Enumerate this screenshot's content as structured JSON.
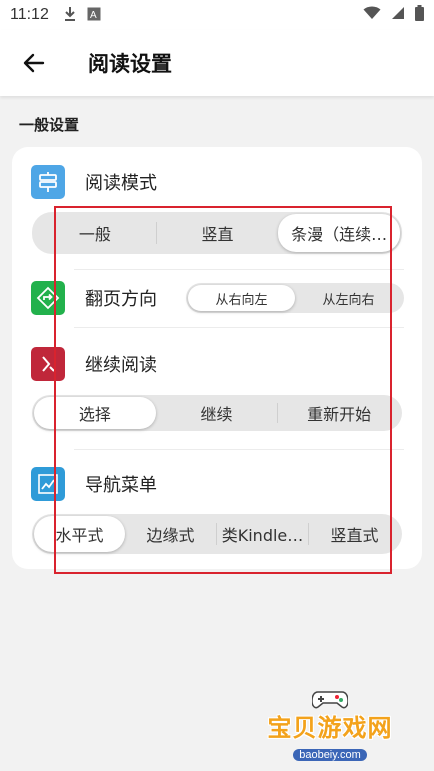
{
  "status_bar": {
    "time": "11:12",
    "icons": [
      "download-icon",
      "a-icon",
      "wifi-icon",
      "signal-icon",
      "battery-icon"
    ]
  },
  "app_bar": {
    "back_icon": "arrow-left-icon",
    "title": "阅读设置"
  },
  "section": {
    "title": "一般设置"
  },
  "settings": {
    "reading_mode": {
      "label": "阅读模式",
      "icon": "signpost-icon",
      "icon_color": "#4ea6e6",
      "options": [
        "一般",
        "竖直",
        "条漫（连续…"
      ],
      "selected": 2
    },
    "page_direction": {
      "label": "翻页方向",
      "icon": "direction-icon",
      "icon_color": "#22b14c",
      "options": [
        "从右向左",
        "从左向右"
      ],
      "selected": 0
    },
    "continue_reading": {
      "label": "继续阅读",
      "icon": "continue-icon",
      "icon_color": "#c0273a",
      "options": [
        "选择",
        "继续",
        "重新开始"
      ],
      "selected": 0
    },
    "nav_menu": {
      "label": "导航菜单",
      "icon": "chart-icon",
      "icon_color": "#2f9bd8",
      "options": [
        "水平式",
        "边缘式",
        "类Kindle…",
        "竖直式"
      ],
      "selected": 0
    }
  },
  "highlight_color": "#d9232e",
  "watermark": {
    "text": "宝贝游戏网",
    "url": "baobeiy.com"
  }
}
